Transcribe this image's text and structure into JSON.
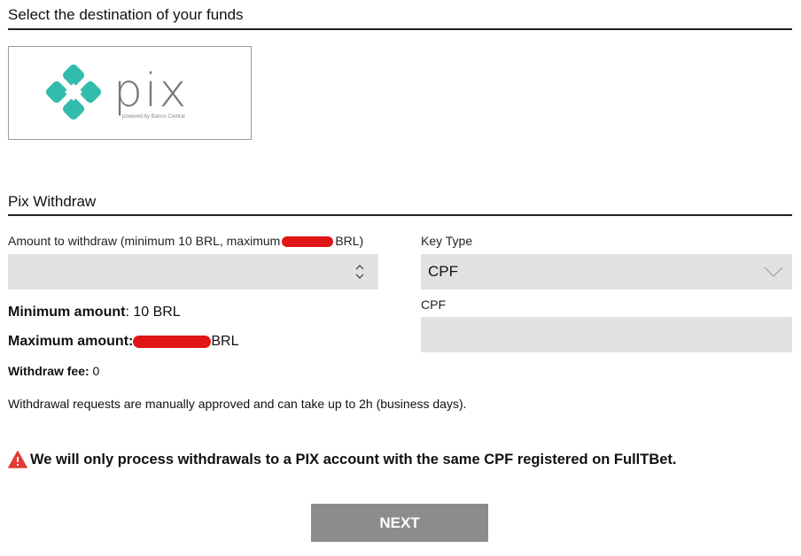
{
  "destination": {
    "title": "Select the destination of your funds",
    "pix_logo_text": "pix",
    "pix_logo_tagline": "powered by Banco Central"
  },
  "withdraw": {
    "title": "Pix Withdraw",
    "amount_label_prefix": "Amount to withdraw (minimum 10 BRL, maximum",
    "amount_label_suffix": "BRL)",
    "amount_value": "",
    "minimum_label": "Minimum amount",
    "minimum_value": ": 10 BRL",
    "maximum_label": "Maximum amount",
    "maximum_prefix": ":",
    "maximum_suffix": "BRL",
    "fee_label": "Withdraw fee:",
    "fee_value": " 0",
    "notice": "Withdrawal requests are manually approved and can take up to 2h (business days).",
    "warning": "We will only process withdrawals to a PIX account with the same CPF registered on FullTBet."
  },
  "key": {
    "type_label": "Key Type",
    "type_value": "CPF",
    "field_label": "CPF",
    "field_value": ""
  },
  "actions": {
    "next_label": "NEXT"
  },
  "colors": {
    "pix_teal": "#32BCAD",
    "warning_red": "#E53935",
    "redaction": "#E01515",
    "button_bg": "#8C8C8C"
  }
}
